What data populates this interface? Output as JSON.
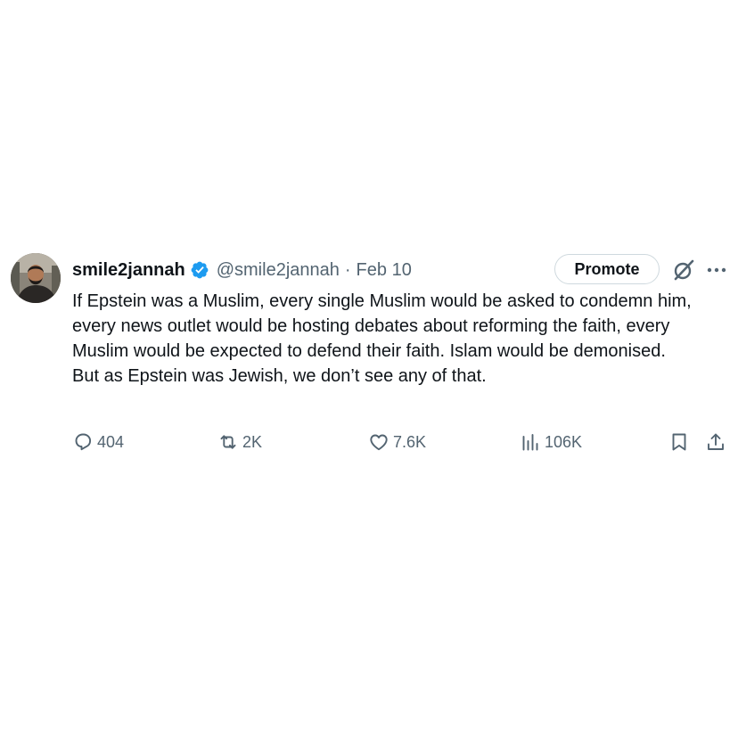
{
  "tweet": {
    "author": {
      "display_name": "smile2jannah",
      "handle": "@smile2jannah",
      "verified": true,
      "verified_color": "#1d9bf0"
    },
    "separator": "·",
    "date": "Feb 10",
    "promote_label": "Promote",
    "text_lines": [
      "If Epstein was a Muslim, every single Muslim would be asked to condemn him, every news outlet would be hosting debates about reforming the faith, every Muslim would be expected to defend their faith. Islam would be demonised.",
      "But as Epstein was Jewish, we don’t see any of that."
    ],
    "stats": {
      "replies": "404",
      "reposts": "2K",
      "likes": "7.6K",
      "views": "106K"
    },
    "icons": {
      "reply": "reply-icon",
      "repost": "repost-icon",
      "like": "heart-icon",
      "views": "views-icon",
      "bookmark": "bookmark-icon",
      "share": "share-icon",
      "grok": "grok-icon",
      "more": "more-icon"
    }
  }
}
